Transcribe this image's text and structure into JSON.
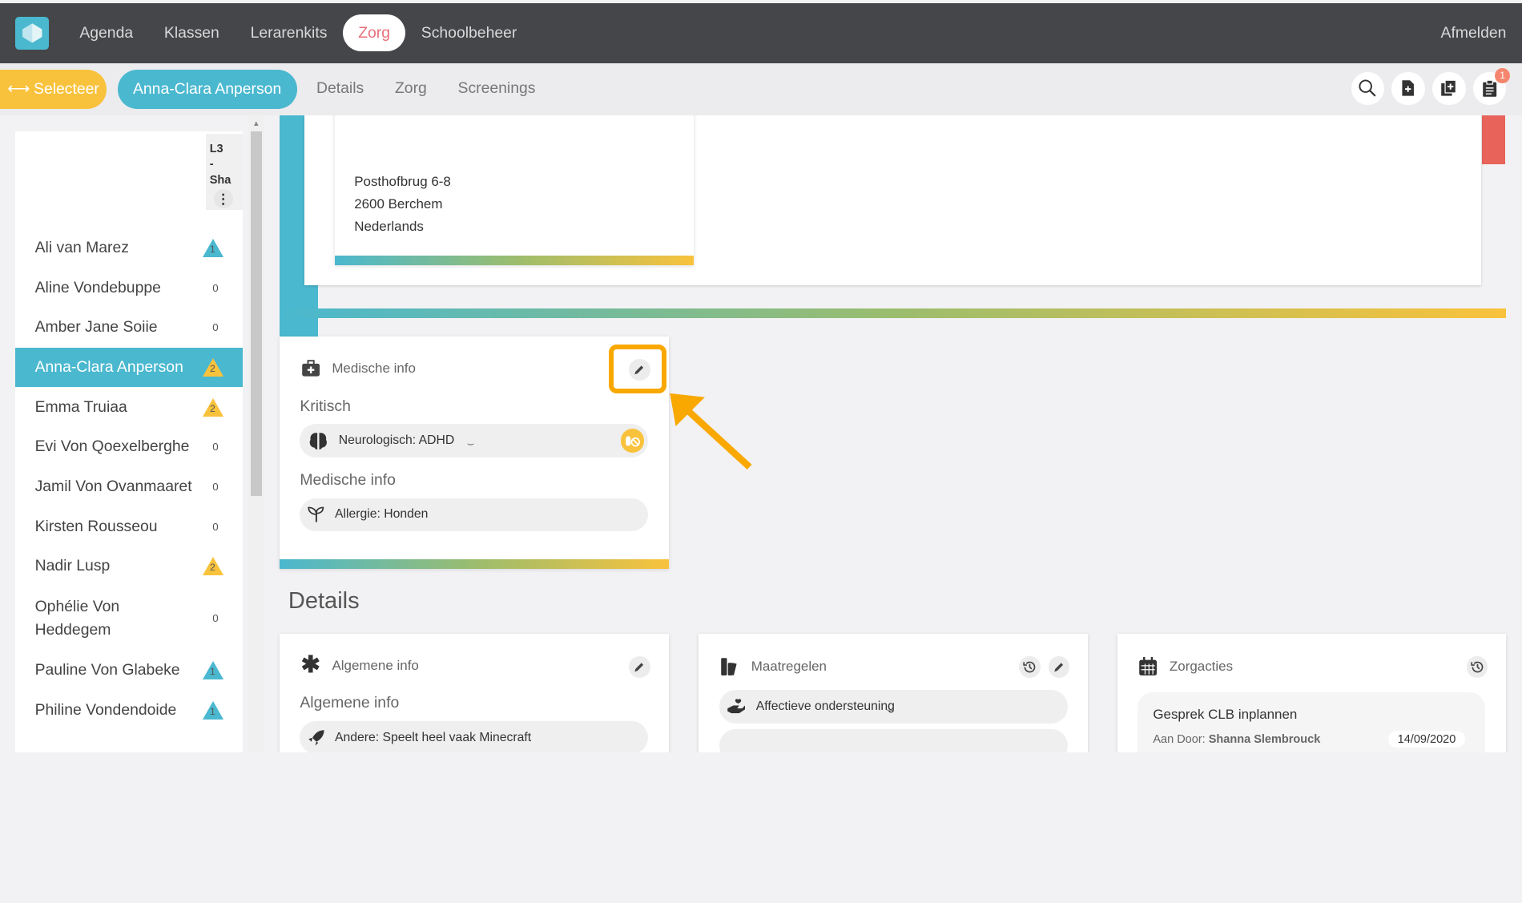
{
  "topnav": {
    "items": [
      "Agenda",
      "Klassen",
      "Lerarenkits",
      "Zorg",
      "Schoolbeheer"
    ],
    "logout": "Afmelden"
  },
  "subbar": {
    "select_label": "Selecteer",
    "student_name": "Anna-Clara Anperson",
    "tabs": [
      "Details",
      "Zorg",
      "Screenings"
    ],
    "notification_count": "1"
  },
  "sidebar": {
    "class_code": [
      "L3",
      "-",
      "Sha"
    ],
    "students": [
      {
        "name": "Ali van Marez",
        "count": "1",
        "marker": "teal"
      },
      {
        "name": "Aline Vondebuppe",
        "count": "0",
        "marker": "none"
      },
      {
        "name": "Amber Jane Soiie",
        "count": "0",
        "marker": "none"
      },
      {
        "name": "Anna-Clara Anperson",
        "count": "2",
        "marker": "yellow",
        "active": true
      },
      {
        "name": "Emma Truiaa",
        "count": "2",
        "marker": "yellow"
      },
      {
        "name": "Evi Von Qoexelberghe",
        "count": "0",
        "marker": "none"
      },
      {
        "name": "Jamil Von Ovanmaaret",
        "count": "0",
        "marker": "none"
      },
      {
        "name": "Kirsten Rousseou",
        "count": "0",
        "marker": "none"
      },
      {
        "name": "Nadir Lusp",
        "count": "2",
        "marker": "yellow"
      },
      {
        "name": "Ophélie Von Heddegem",
        "count": "0",
        "marker": "none",
        "tall": true
      },
      {
        "name": "Pauline Von Glabeke",
        "count": "1",
        "marker": "teal"
      },
      {
        "name": "Philine Vondendoide",
        "count": "1",
        "marker": "teal"
      }
    ]
  },
  "address": {
    "street": "Posthofbrug 6-8",
    "city": "2600 Berchem",
    "country": "Nederlands"
  },
  "medical": {
    "title": "Medische info",
    "critical_label": "Kritisch",
    "critical_item": "Neurologisch: ADHD",
    "info_label": "Medische info",
    "info_item": "Allergie: Honden"
  },
  "details": {
    "heading": "Details",
    "general": {
      "title": "Algemene info",
      "label": "Algemene info",
      "item": "Andere: Speelt heel vaak Minecraft"
    },
    "measures": {
      "title": "Maatregelen",
      "item": "Affectieve ondersteuning"
    },
    "care_actions": {
      "title": "Zorgacties",
      "item_title": "Gesprek CLB inplannen",
      "item_meta_prefix": "Aan Door:",
      "item_person": "Shanna Slembrouck",
      "item_date": "14/09/2020"
    }
  },
  "colors": {
    "teal": "#4ab8cf",
    "yellow": "#f9c23c",
    "topbar": "#454649",
    "highlight": "#f9a800",
    "active_nav_text": "#e8707a"
  }
}
